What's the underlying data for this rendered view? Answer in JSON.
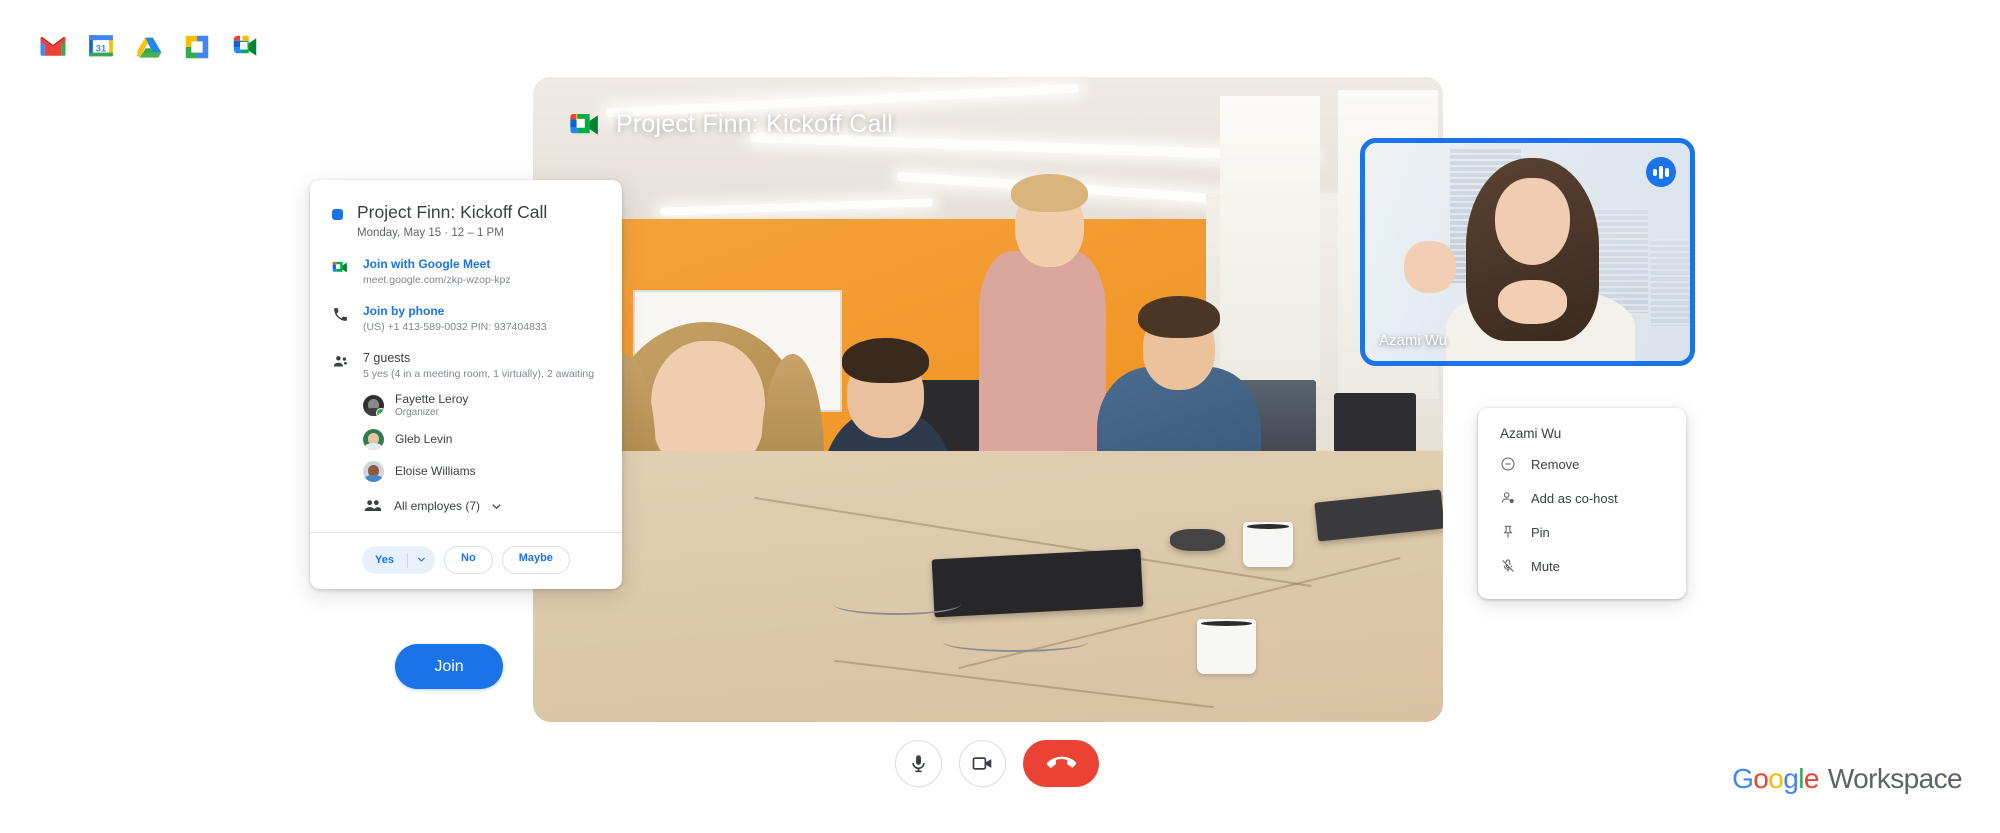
{
  "app_strip": {
    "icons": [
      {
        "name": "gmail-icon",
        "label": "Gmail"
      },
      {
        "name": "google-calendar-icon",
        "label": "Calendar",
        "day": "31"
      },
      {
        "name": "google-drive-icon",
        "label": "Drive"
      },
      {
        "name": "google-docs-icon",
        "label": "Docs"
      },
      {
        "name": "google-meet-icon",
        "label": "Meet"
      }
    ]
  },
  "meeting": {
    "title": "Project Finn: Kickoff Call",
    "self_tile": {
      "participant_name": "Azami Wu",
      "speaking_indicator": "speaking-indicator-icon",
      "border_color": "#1a73e8"
    },
    "controls": [
      {
        "name": "microphone-button",
        "icon": "microphone-icon"
      },
      {
        "name": "camera-button",
        "icon": "video-camera-icon"
      },
      {
        "name": "end-call-button",
        "icon": "hang-up-icon",
        "color": "#ea4335"
      }
    ]
  },
  "context_menu": {
    "title": "Azami Wu",
    "items": [
      {
        "label": "Remove",
        "icon": "remove-circle-icon"
      },
      {
        "label": "Add as co-host",
        "icon": "person-add-icon"
      },
      {
        "label": "Pin",
        "icon": "pin-icon"
      },
      {
        "label": "Mute",
        "icon": "mic-off-icon"
      }
    ]
  },
  "event_card": {
    "color": "#1a73e8",
    "title": "Project Finn: Kickoff Call",
    "datetime": "Monday, May 15  ·  12 – 1 PM",
    "meet": {
      "link_label": "Join with Google Meet",
      "url": "meet.google.com/zkp-wzop-kpz",
      "icon": "google-meet-icon"
    },
    "phone": {
      "link_label": "Join by phone",
      "details": "(US) +1 413-589-0032 PIN: 937404833",
      "icon": "phone-icon"
    },
    "guests": {
      "icon": "people-icon",
      "count_label": "7 guests",
      "summary": "5 yes (4 in a meeting room, 1 virtually), 2 awaiting",
      "list": [
        {
          "name": "Fayette Leroy",
          "role": "Organizer",
          "accepted": true,
          "skin": "#8a8a8a",
          "shirt": "#3f3f3f",
          "bg": "#2f2f2f"
        },
        {
          "name": "Gleb Levin",
          "role": "",
          "accepted": false,
          "skin": "#e8c3a2",
          "shirt": "#e8eaed",
          "bg": "#2e7d4f"
        },
        {
          "name": "Eloise Williams",
          "role": "",
          "accepted": false,
          "skin": "#8d5a3b",
          "shirt": "#4a86c7",
          "bg": "#cfd5da"
        }
      ],
      "group_label": "All employes (7)",
      "group_icon": "group-icon",
      "group_chevron": "chevron-down-icon"
    },
    "rsvp": {
      "yes": "Yes",
      "yes_dropdown": "chevron-down-icon",
      "no": "No",
      "maybe": "Maybe"
    }
  },
  "join_button": {
    "label": "Join"
  },
  "brand": {
    "google": "Google",
    "workspace": "Workspace"
  }
}
